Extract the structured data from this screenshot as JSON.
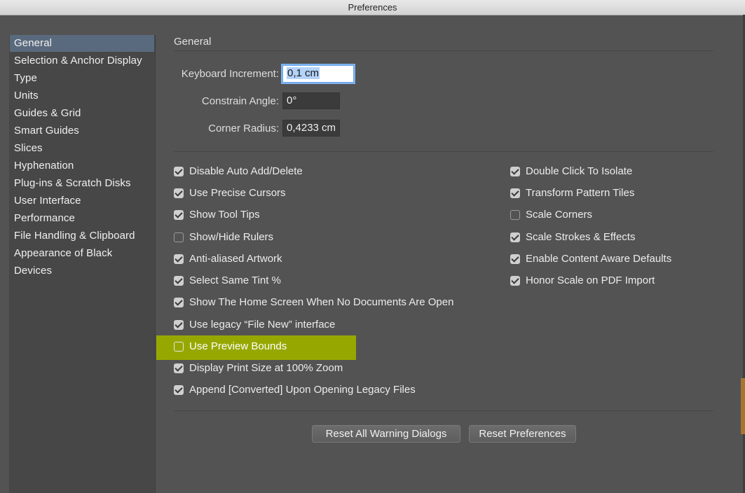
{
  "window": {
    "title": "Preferences"
  },
  "sidebar": {
    "items": [
      {
        "label": "General",
        "selected": true
      },
      {
        "label": "Selection & Anchor Display"
      },
      {
        "label": "Type"
      },
      {
        "label": "Units"
      },
      {
        "label": "Guides & Grid"
      },
      {
        "label": "Smart Guides"
      },
      {
        "label": "Slices"
      },
      {
        "label": "Hyphenation"
      },
      {
        "label": "Plug-ins & Scratch Disks"
      },
      {
        "label": "User Interface"
      },
      {
        "label": "Performance"
      },
      {
        "label": "File Handling & Clipboard"
      },
      {
        "label": "Appearance of Black"
      },
      {
        "label": "Devices"
      }
    ]
  },
  "main": {
    "section_title": "General",
    "fields": {
      "keyboard_increment": {
        "label": "Keyboard Increment:",
        "value": "0,1 cm"
      },
      "constrain_angle": {
        "label": "Constrain Angle:",
        "value": "0°"
      },
      "corner_radius": {
        "label": "Corner Radius:",
        "value": "0,4233 cm"
      }
    },
    "left_options": [
      {
        "label": "Disable Auto Add/Delete",
        "checked": true
      },
      {
        "label": "Use Precise Cursors",
        "checked": true
      },
      {
        "label": "Show Tool Tips",
        "checked": true
      },
      {
        "label": "Show/Hide Rulers",
        "checked": false
      },
      {
        "label": "Anti-aliased Artwork",
        "checked": true
      },
      {
        "label": "Select Same Tint %",
        "checked": true
      },
      {
        "label": "Show The Home Screen When No Documents Are Open",
        "checked": true
      },
      {
        "label": "Use legacy “File New” interface",
        "checked": true
      },
      {
        "label": "Use Preview Bounds",
        "checked": false,
        "highlighted": true
      },
      {
        "label": "Display Print Size at 100% Zoom",
        "checked": true
      },
      {
        "label": "Append [Converted] Upon Opening Legacy Files",
        "checked": true
      }
    ],
    "right_options": [
      {
        "label": "Double Click To Isolate",
        "checked": true
      },
      {
        "label": "Transform Pattern Tiles",
        "checked": true
      },
      {
        "label": "Scale Corners",
        "checked": false
      },
      {
        "label": "Scale Strokes & Effects",
        "checked": true
      },
      {
        "label": "Enable Content Aware Defaults",
        "checked": true
      },
      {
        "label": "Honor Scale on PDF Import",
        "checked": true
      }
    ],
    "buttons": {
      "reset_warnings": "Reset All Warning Dialogs",
      "reset_preferences": "Reset Preferences"
    }
  },
  "colors": {
    "background": "#535353",
    "sidebar": "#474747",
    "selection": "#5a6a7e",
    "highlight": "#96a800"
  }
}
